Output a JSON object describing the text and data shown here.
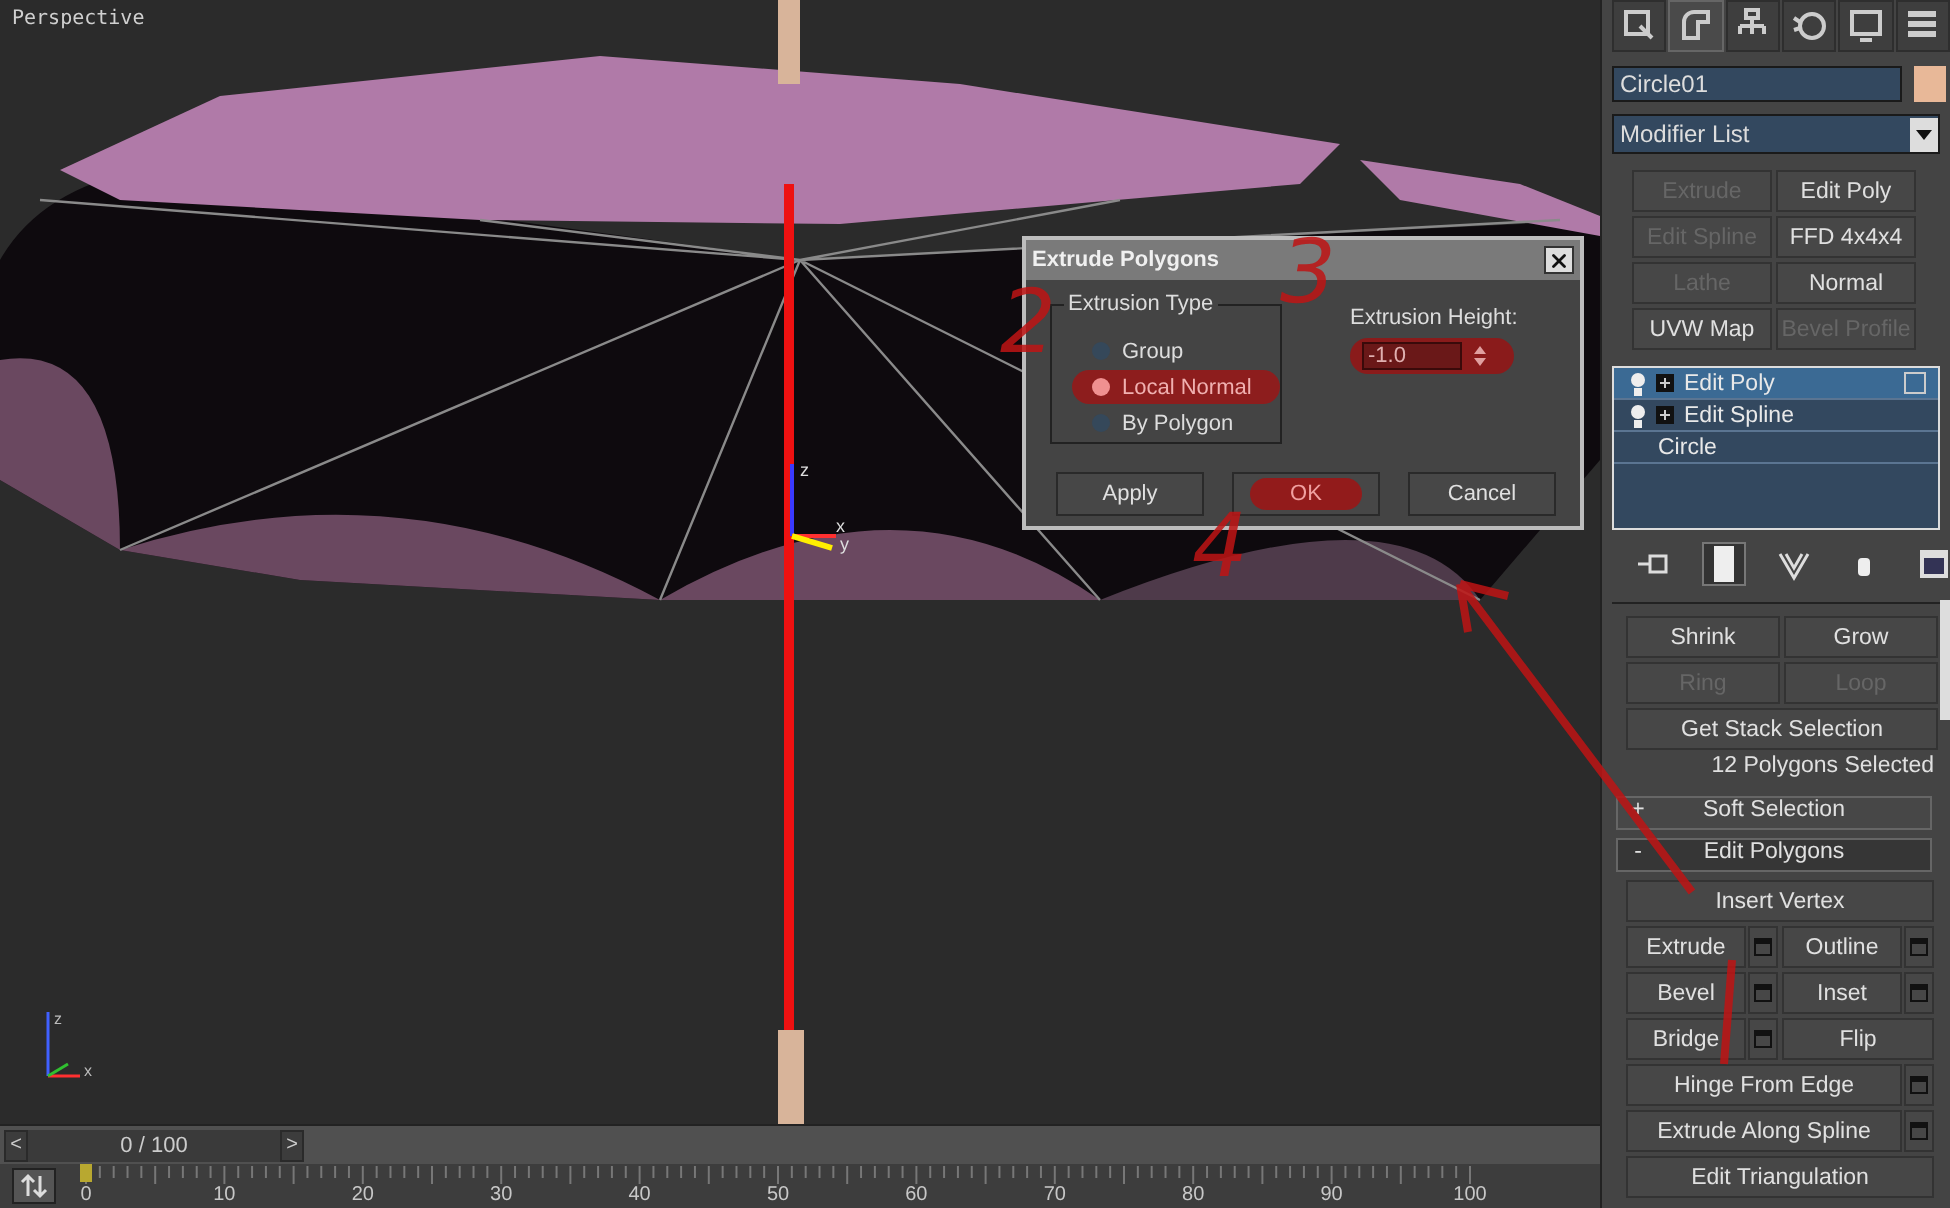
{
  "viewport": {
    "label": "Perspective",
    "gizmo_labels": [
      "z",
      "x",
      "y"
    ],
    "corner_axis_labels": [
      "z",
      "x"
    ]
  },
  "dialog": {
    "title": "Extrude Polygons",
    "group_title": "Extrusion Type",
    "options": [
      {
        "label": "Group",
        "selected": false
      },
      {
        "label": "Local Normal",
        "selected": true
      },
      {
        "label": "By Polygon",
        "selected": false
      }
    ],
    "height_label": "Extrusion Height:",
    "height_value": "-1.0",
    "buttons": [
      "Apply",
      "OK",
      "Cancel"
    ]
  },
  "annotations": [
    "2",
    "3",
    "4"
  ],
  "command_panel": {
    "tabs": [
      {
        "selected": false
      },
      {
        "selected": true
      },
      {
        "selected": false
      },
      {
        "selected": false
      },
      {
        "selected": false
      },
      {
        "selected": false
      }
    ],
    "object_name": "Circle01",
    "modifier_list": "Modifier List",
    "modifier_buttons": [
      {
        "label": "Extrude",
        "disabled": true
      },
      {
        "label": "Edit Poly",
        "disabled": false
      },
      {
        "label": "Edit Spline",
        "disabled": true
      },
      {
        "label": "FFD 4x4x4",
        "disabled": false
      },
      {
        "label": "Lathe",
        "disabled": true
      },
      {
        "label": "Normal",
        "disabled": false
      },
      {
        "label": "UVW Map",
        "disabled": false
      },
      {
        "label": "Bevel Profile",
        "disabled": true
      }
    ],
    "stack": [
      {
        "label": "Edit Poly",
        "selected": true,
        "kind": "modifier"
      },
      {
        "label": "Edit Spline",
        "selected": false,
        "kind": "modifier"
      },
      {
        "label": "Circle",
        "selected": false,
        "kind": "base"
      }
    ],
    "stack_tools": [
      {
        "selected": false
      },
      {
        "selected": true
      },
      {
        "selected": false
      },
      {
        "selected": false
      },
      {
        "selected": false
      }
    ],
    "selection_buttons": [
      {
        "label": "Shrink",
        "disabled": false
      },
      {
        "label": "Grow",
        "disabled": false
      },
      {
        "label": "Ring",
        "disabled": true
      },
      {
        "label": "Loop",
        "disabled": true
      }
    ],
    "stack_selection_button": "Get Stack Selection",
    "selection_info": "12 Polygons Selected",
    "rollouts": [
      {
        "sign": "+",
        "label": "Soft Selection",
        "expanded": false
      },
      {
        "sign": "-",
        "label": "Edit Polygons",
        "expanded": true
      }
    ],
    "edit_buttons": [
      {
        "label": "Insert Vertex",
        "kind": "wide",
        "settings": false
      },
      {
        "label": "Extrude",
        "kind": "half",
        "settings": true
      },
      {
        "label": "Outline",
        "kind": "half",
        "settings": true
      },
      {
        "label": "Bevel",
        "kind": "half",
        "settings": true
      },
      {
        "label": "Inset",
        "kind": "half",
        "settings": true
      },
      {
        "label": "Bridge",
        "kind": "half",
        "settings": true
      },
      {
        "label": "Flip",
        "kind": "half",
        "settings": false
      },
      {
        "label": "Hinge From Edge",
        "kind": "wide",
        "settings": true
      },
      {
        "label": "Extrude Along Spline",
        "kind": "wide",
        "settings": true
      },
      {
        "label": "Edit Triangulation",
        "kind": "wide",
        "settings": false
      }
    ]
  },
  "time_slider": {
    "prev": "<",
    "position": "0 / 100",
    "next": ">"
  },
  "ruler_labels": [
    "0",
    "10",
    "20",
    "30",
    "40",
    "50",
    "60",
    "70",
    "80",
    "90",
    "100"
  ]
}
